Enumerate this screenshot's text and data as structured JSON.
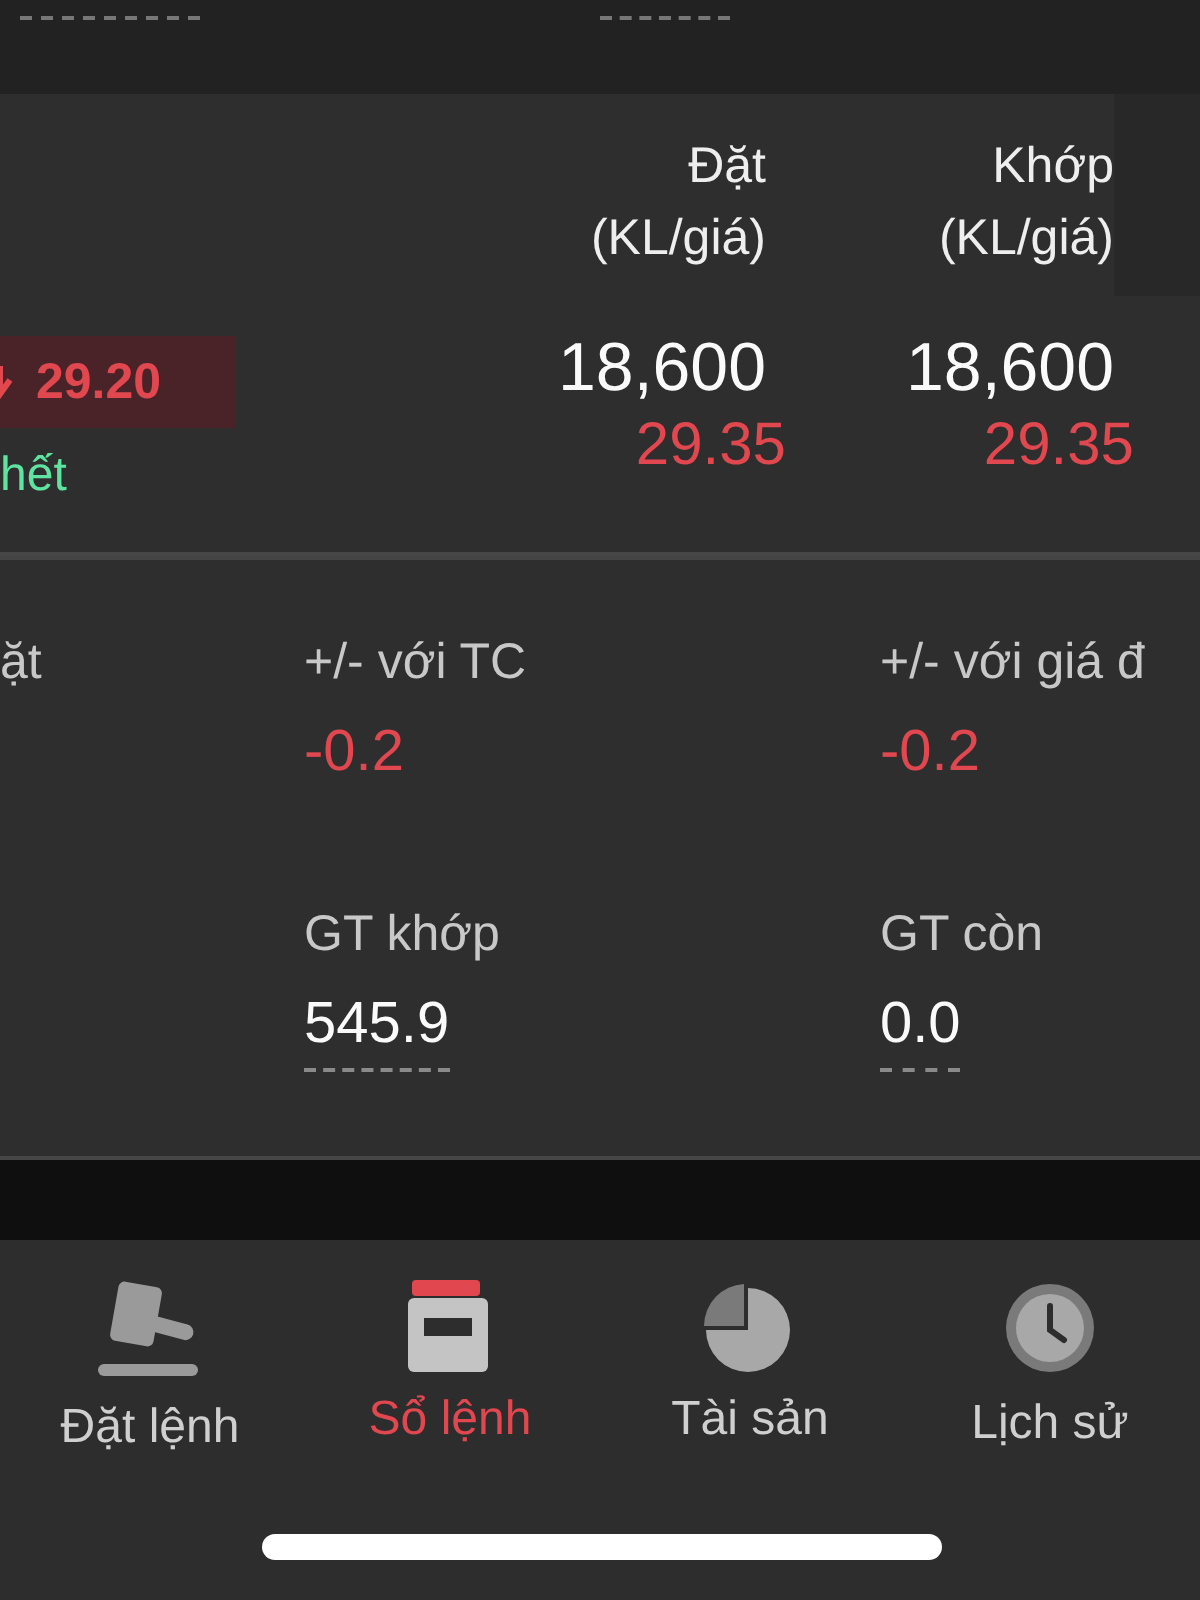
{
  "header": {
    "columns": [
      {
        "title": "Đặt",
        "subtitle": "(KL/giá)"
      },
      {
        "title": "Khớp",
        "subtitle": "(KL/giá)"
      }
    ]
  },
  "order": {
    "price_badge": "29.20",
    "status": "hết",
    "cells": [
      {
        "volume": "18,600",
        "price": "29.35"
      },
      {
        "volume": "18,600",
        "price": "29.35"
      }
    ]
  },
  "details": {
    "cut_label": "ặt",
    "fields": [
      {
        "label": "+/- với TC",
        "value": "-0.2",
        "kind": "change"
      },
      {
        "label": "+/- với giá đ",
        "value": "-0.2",
        "kind": "change"
      },
      {
        "label": "GT khớp",
        "value": "545.9",
        "kind": "amount"
      },
      {
        "label": "GT còn",
        "value": "0.0",
        "kind": "amount"
      }
    ]
  },
  "nav": [
    {
      "label": "Đặt lệnh",
      "selected": false
    },
    {
      "label": "Sổ lệnh",
      "selected": true
    },
    {
      "label": "Tài sản",
      "selected": false
    },
    {
      "label": "Lịch sử",
      "selected": false
    }
  ]
}
